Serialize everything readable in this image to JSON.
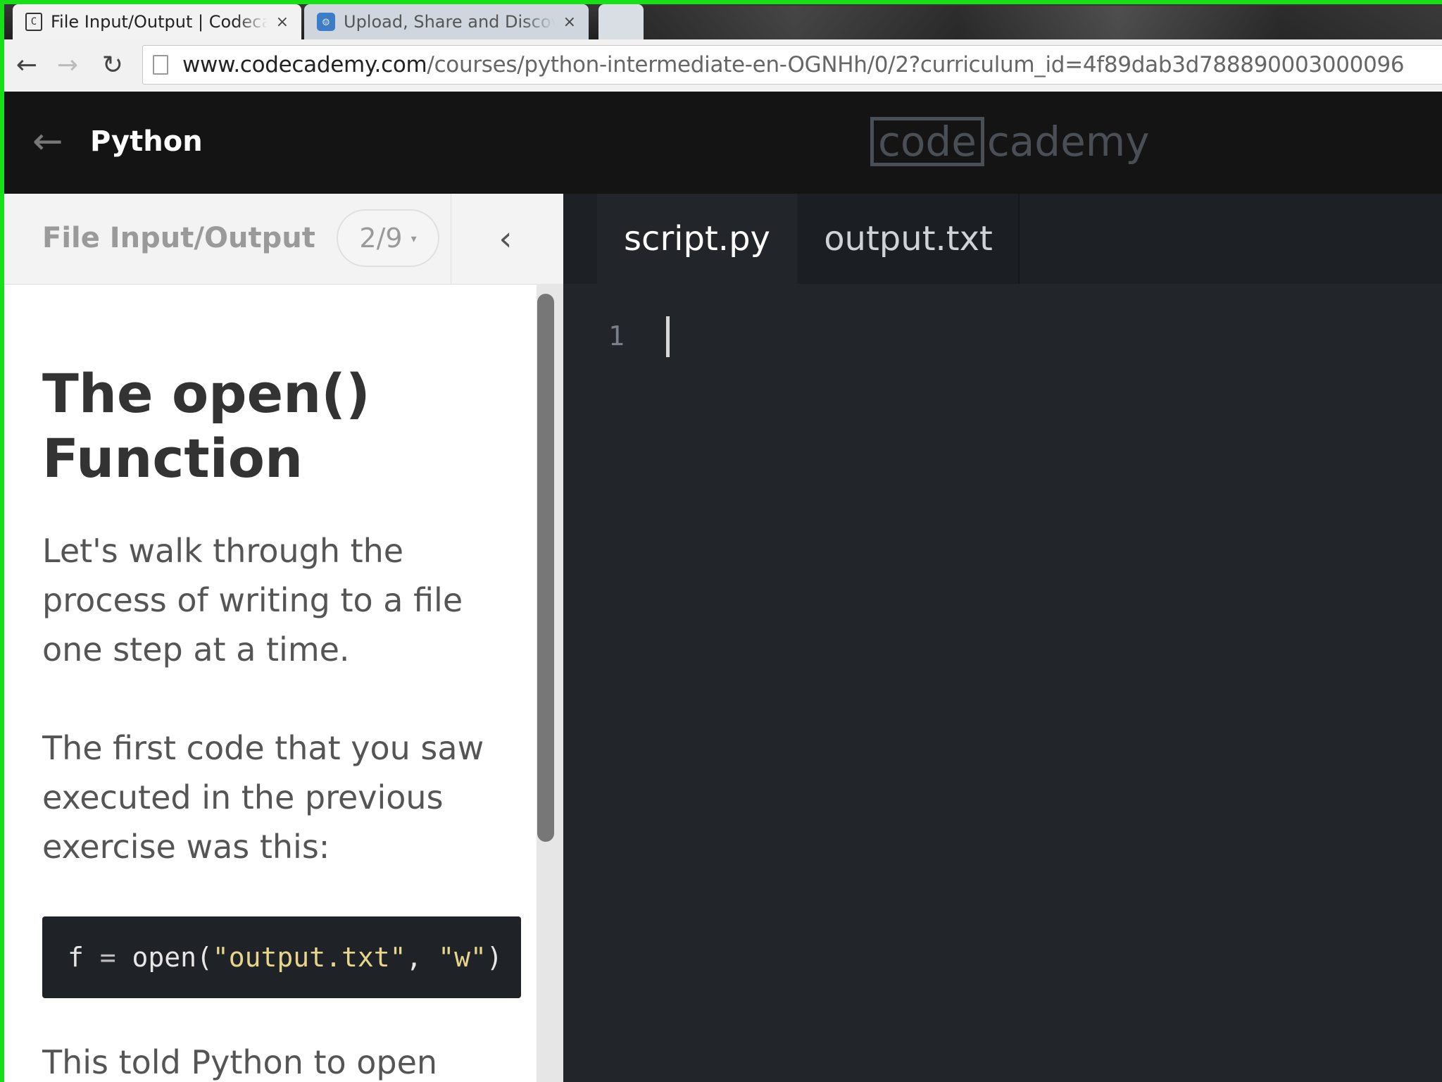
{
  "browser": {
    "tabs": [
      {
        "title": "File Input/Output | Codecademy",
        "favicon": "codecademy-favicon",
        "close": "×"
      },
      {
        "title": "Upload, Share and Discover",
        "favicon": "upload-site-favicon",
        "close": "×"
      }
    ],
    "url_host": "www.codecademy.com",
    "url_path": "/courses/python-intermediate-en-OGNHh/0/2?curriculum_id=4f89dab3d788890003000096",
    "nav": {
      "back": "←",
      "forward": "→",
      "reload": "↻"
    }
  },
  "header": {
    "back_icon": "←",
    "course": "Python",
    "logo_boxed": "code",
    "logo_rest": "cademy"
  },
  "lesson": {
    "unit": "File Input/Output",
    "progress": "2/9",
    "progress_caret": "▾",
    "collapse_icon": "‹",
    "title": "The open() Function",
    "para1": "Let's walk through the process of writing to a file one step at a time.",
    "para2": "The first code that you saw executed in the previous exercise was this:",
    "code": {
      "var": "f",
      "eq": " = ",
      "fn": "open(",
      "arg1": "\"output.txt\"",
      "sep": ", ",
      "arg2": "\"w\"",
      "close": ")"
    },
    "para3": "This told Python to open"
  },
  "editor": {
    "tabs": [
      "script.py",
      "output.txt"
    ],
    "line_number": "1"
  },
  "colors": {
    "accent_border": "#18e018",
    "editor_bg": "#22262b",
    "header_bg": "#141414"
  }
}
